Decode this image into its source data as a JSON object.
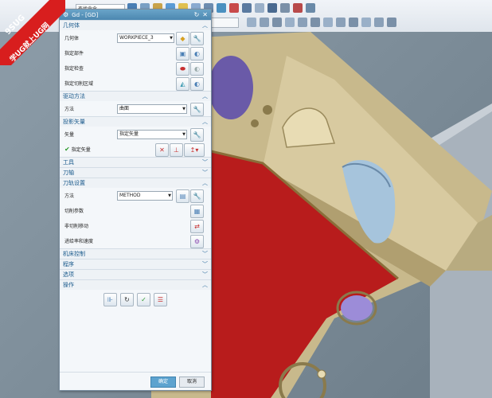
{
  "toolbar": {
    "command_finder": "查找命令"
  },
  "watermark": {
    "line1": "9SUG",
    "line2": "学UG就上UG网"
  },
  "dialog": {
    "title": "Gd - [GD]",
    "sections": {
      "geometry": {
        "header": "几何体",
        "geometry_label": "几何体",
        "geometry_value": "WORKPIECE_3",
        "specify_part": "指定部件",
        "specify_check": "指定检查",
        "specify_cut_area": "指定切削区域"
      },
      "drive_method": {
        "header": "驱动方法",
        "method_label": "方法",
        "method_value": "曲面"
      },
      "projection_vector": {
        "header": "投影矢量",
        "vector_label": "矢量",
        "vector_value": "指定矢量",
        "specify_vector": "指定矢量"
      },
      "tool": {
        "header": "工具"
      },
      "tool_axis": {
        "header": "刀轴"
      },
      "path_settings": {
        "header": "刀轨设置",
        "method_label": "方法",
        "method_value": "METHOD",
        "cut_params": "切削参数",
        "non_cut_moves": "非切削移动",
        "feeds_speeds": "进给率和速度"
      },
      "machine_control": {
        "header": "机床控制"
      },
      "program": {
        "header": "程序"
      },
      "options": {
        "header": "选项"
      },
      "actions": {
        "header": "操作"
      }
    },
    "ok_label": "确定",
    "cancel_label": "取消"
  },
  "colors": {
    "part_tan": "#c8b98c",
    "cut_area_red": "#b81c1c",
    "hole_blue": "#a6c4dc",
    "hole_violet": "#9c8cd8",
    "dialog_title": "#4b87b0",
    "ok_button": "#5da3cf"
  }
}
